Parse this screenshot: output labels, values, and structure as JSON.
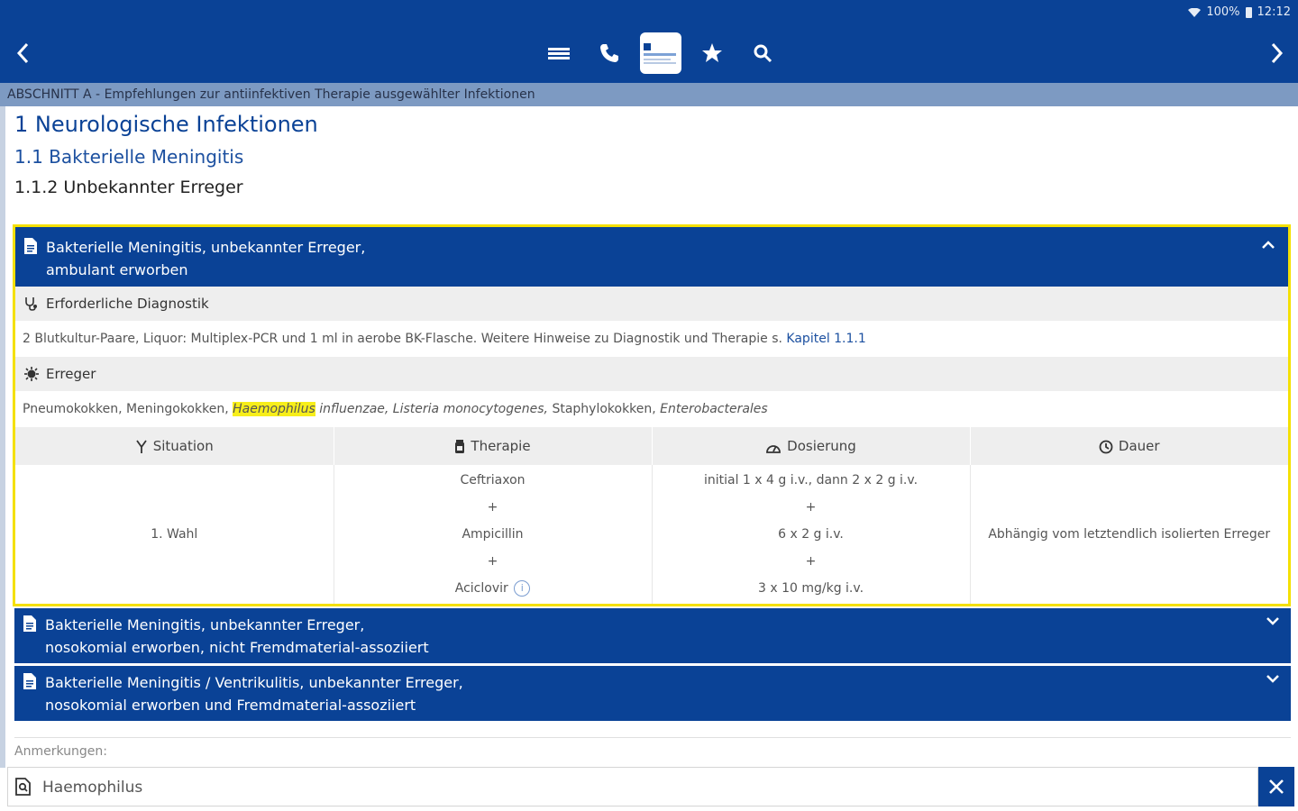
{
  "status_bar": {
    "battery": "100%",
    "time": "12:12"
  },
  "section_bar": {
    "text": "ABSCHNITT A - Empfehlungen zur antiinfektiven Therapie ausgewählter Infektionen"
  },
  "headings": {
    "h1": "1 Neurologische Infektionen",
    "h2": "1.1 Bakterielle Meningitis",
    "h3": "1.1.2 Unbekannter Erreger"
  },
  "card": {
    "title_line1": "Bakterielle Meningitis, unbekannter Erreger,",
    "title_line2": "ambulant erworben",
    "diagnostik_label": "Erforderliche Diagnostik",
    "diagnostik_text": "2 Blutkultur-Paare, Liquor: Multiplex-PCR und 1 ml in aerobe BK-Flasche. Weitere Hinweise zu Diagnostik und Therapie s.",
    "diagnostik_link": "Kapitel 1.1.1",
    "erreger_label": "Erreger",
    "erreger_plain1": "Pneumokokken, Meningokokken,",
    "erreger_highlight": "Haemophilus",
    "erreger_em1": "influenzae, Listeria monocytogenes,",
    "erreger_plain2": "Staphylokokken,",
    "erreger_em2": "Enterobacterales",
    "table": {
      "headers": [
        "Situation",
        "Therapie",
        "Dosierung",
        "Dauer"
      ],
      "situation": "1. Wahl",
      "therapie": [
        "Ceftriaxon",
        "+",
        "Ampicillin",
        "+",
        "Aciclovir"
      ],
      "dosierung": [
        "initial 1 x 4 g i.v., dann 2 x 2 g i.v.",
        "+",
        "6 x 2 g i.v.",
        "+",
        "3 x 10 mg/kg i.v."
      ],
      "dauer": "Abhängig vom letztendlich isolierten Erreger",
      "info_symbol": "i"
    }
  },
  "accordions": [
    {
      "line1": "Bakterielle Meningitis, unbekannter Erreger,",
      "line2": "nosokomial erworben, nicht Fremdmaterial-assoziiert"
    },
    {
      "line1": "Bakterielle Meningitis / Ventrikulitis, unbekannter Erreger,",
      "line2": "nosokomial erworben und Fremdmaterial-assoziiert"
    }
  ],
  "notes_label": "Anmerkungen:",
  "search": {
    "value": "Haemophilus"
  },
  "colors": {
    "primary": "#0a4296",
    "highlight": "#f7ee1a",
    "section_bar": "#7d9ac2"
  },
  "icons": [
    "back-arrow-icon",
    "menu-icon",
    "phone-icon",
    "app-logo-icon",
    "star-icon",
    "search-icon",
    "forward-arrow-icon",
    "document-icon",
    "chevron-up-icon",
    "chevron-down-icon",
    "stethoscope-icon",
    "virus-icon",
    "branch-icon",
    "pill-icon",
    "gauge-icon",
    "clock-icon",
    "close-icon",
    "wifi-icon",
    "battery-icon"
  ]
}
